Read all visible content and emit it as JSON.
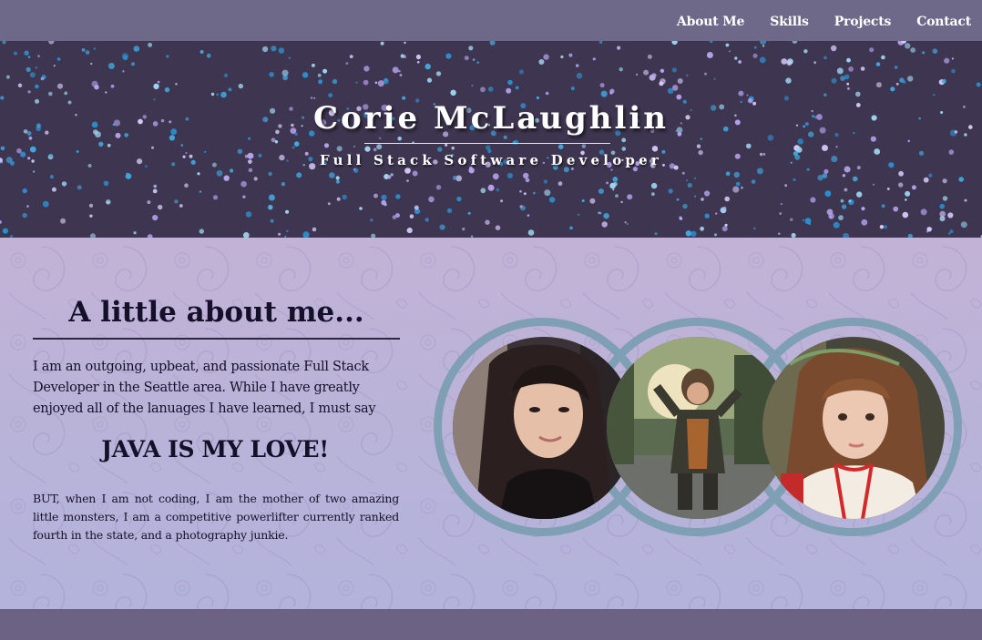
{
  "nav": {
    "links": [
      {
        "label": "About Me"
      },
      {
        "label": "Skills"
      },
      {
        "label": "Projects"
      },
      {
        "label": "Contact"
      }
    ]
  },
  "hero": {
    "title": "Corie McLaughlin",
    "subtitle": "Full Stack Software Developer"
  },
  "about": {
    "heading": "A little about me...",
    "intro": "I am an outgoing, upbeat, and passionate Full Stack Developer in the Seattle area. While I have greatly enjoyed all of the lanuages I have learned, I must say",
    "emphasis": "JAVA IS MY LOVE!",
    "body": "BUT, when I am not coding, I am the mother of two amazing little monsters, I am a competitive powerlifter currently ranked fourth in the state, and a photography junkie."
  },
  "photos": [
    {
      "name": "portrait-photo-woman"
    },
    {
      "name": "portrait-photo-child-costume"
    },
    {
      "name": "portrait-photo-girl-red-ribbon"
    }
  ],
  "colors": {
    "nav": "#6e6889",
    "hero": "#3e3650",
    "about": "#b9b4d6",
    "ring": "#7f9fb4",
    "footer": "#6c6283"
  }
}
